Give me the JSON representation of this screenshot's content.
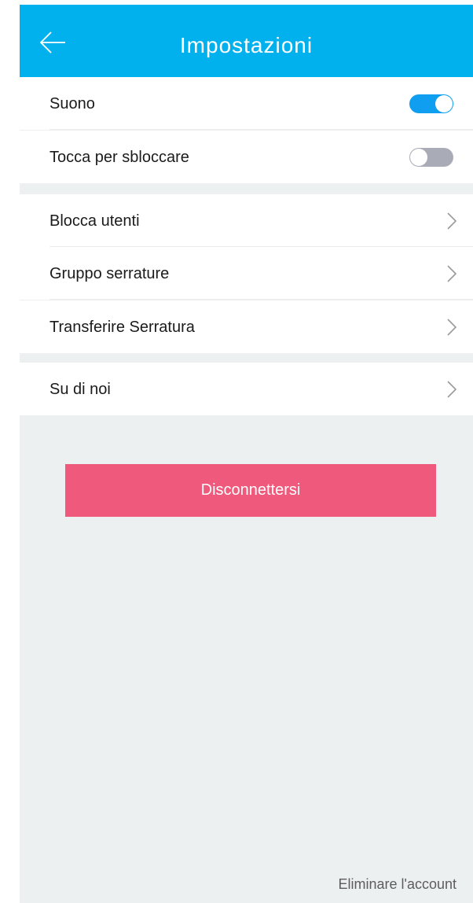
{
  "header": {
    "title": "Impostazioni"
  },
  "section1": [
    {
      "label": "Suono",
      "toggle": "on"
    },
    {
      "label": "Tocca per sbloccare",
      "toggle": "off"
    }
  ],
  "section2": [
    {
      "label": "Blocca utenti"
    },
    {
      "label": "Gruppo serrature"
    },
    {
      "label": "Transferire Serratura"
    }
  ],
  "section3": [
    {
      "label": "Su di noi"
    }
  ],
  "buttons": {
    "logout": "Disconnettersi",
    "delete_account": "Eliminare l'account"
  },
  "colors": {
    "header": "#00b1ee",
    "toggle_on": "#0f9ef0",
    "toggle_off": "#a9abb6",
    "logout": "#ef5a7c",
    "background": "#ecf0f1"
  },
  "icons": {
    "back": "arrow-left-icon",
    "row": "chevron-right-icon"
  }
}
